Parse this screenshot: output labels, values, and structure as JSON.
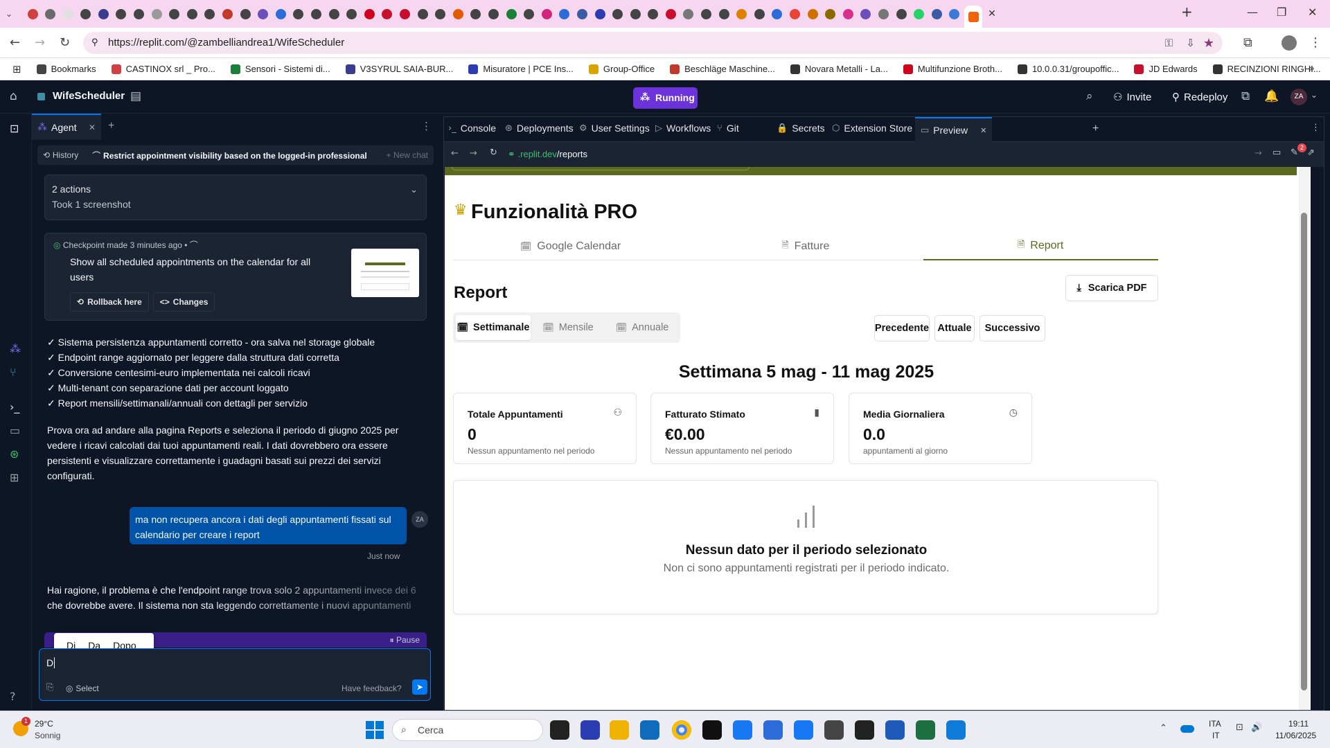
{
  "browser": {
    "url": "https://replit.com/@zambelliandrea1/WifeScheduler",
    "bookmarks": [
      "Bookmarks",
      "CASTINOX srl _ Pro...",
      "Sensori - Sistemi di...",
      "V3SYRUL SAIA-BUR...",
      "Misuratore | PCE Ins...",
      "Group-Office",
      "Beschläge Maschine...",
      "Novara Metalli - La...",
      "Multifunzione Broth...",
      "10.0.0.31/groupoffic...",
      "JD Edwards",
      "RECINZIONI RINGHI..."
    ],
    "bookmark_colors": [
      "#444444",
      "#d04040",
      "#1a7f37",
      "#3b3b8f",
      "#2b3bb0",
      "#d9a400",
      "#c0392b",
      "#333333",
      "#d0021b",
      "#333333",
      "#c8102e",
      "#333333"
    ]
  },
  "app": {
    "project_name": "WifeScheduler",
    "status": "Running",
    "invite": "Invite",
    "redeploy": "Redeploy",
    "avatar": "ZA"
  },
  "agent": {
    "tab_label": "Agent",
    "history": "History",
    "chat_title": "Restrict appointment visibility based on the logged-in professional",
    "new_chat": "New chat",
    "actions_title": "2 actions",
    "actions_sub": "Took 1 screenshot",
    "checkpoint_label": "Checkpoint made",
    "checkpoint_time": "3 minutes ago",
    "checkpoint_text": "Show all scheduled appointments on the calendar for all users",
    "rollback": "Rollback here",
    "changes": "Changes",
    "checklist": [
      "✓ Sistema persistenza appuntamenti corretto - ora salva nel storage globale",
      "✓ Endpoint range aggiornato per leggere dalla struttura dati corretta",
      "✓ Conversione centesimi-euro implementata nei calcoli ricavi",
      "✓ Multi-tenant con separazione dati per account loggato",
      "✓ Report mensili/settimanali/annuali con dettagli per servizio"
    ],
    "paragraph": "Prova ora ad andare alla pagina Reports e seleziona il periodo di giugno 2025 per vedere i ricavi calcolati dai tuoi appuntamenti reali. I dati dovrebbero ora essere persistenti e visualizzare correttamente i guadagni basati sui prezzi dei servizi configurati.",
    "user_message": "ma non recupera ancora i dati degli appuntamenti fissati sul calendario per creare i report",
    "user_avatar": "ZA",
    "user_time": "Just now",
    "reply": "Hai ragione, il problema è che l'endpoint range trova solo 2 appuntamenti invece dei 6 che dovrebbe avere. Il sistema non sta leggendo correttamente i nuovi appuntamenti persist",
    "suggestions": [
      "Di",
      "Da",
      "Dopo"
    ],
    "pause": "Pause",
    "input_value": "D",
    "select": "Select",
    "feedback": "Have feedback?"
  },
  "tabs": [
    "Console",
    "Deployments",
    "User Settings",
    "Workflows",
    "Git",
    "Secrets",
    "Extension Store",
    "Preview"
  ],
  "preview_url": {
    "host": ".replit.dev",
    "path": "/reports"
  },
  "notif_count": "2",
  "page": {
    "title": "Funzionalità PRO",
    "feature_tabs": [
      "Google Calendar",
      "Fatture",
      "Report"
    ],
    "active_tab": "Report",
    "section_title": "Report",
    "download_pdf": "Scarica PDF",
    "periods": [
      "Settimanale",
      "Mensile",
      "Annuale"
    ],
    "nav": [
      "Precedente",
      "Attuale",
      "Successivo"
    ],
    "week_title": "Settimana 5 mag - 11 mag 2025",
    "stats": [
      {
        "label": "Totale Appuntamenti",
        "value": "0",
        "sub": "Nessun appuntamento nel periodo",
        "icon": "user-check-icon"
      },
      {
        "label": "Fatturato Stimato",
        "value": "€0.00",
        "sub": "Nessun appuntamento nel periodo",
        "icon": "bar-chart-icon"
      },
      {
        "label": "Media Giornaliera",
        "value": "0.0",
        "sub": "appuntamenti al giorno",
        "icon": "clock-icon"
      }
    ],
    "empty_title": "Nessun dato per il periodo selezionato",
    "empty_sub": "Non ci sono appuntamenti registrati per il periodo indicato.",
    "accent": "#5c6a1f"
  },
  "taskbar": {
    "weather_temp": "29°C",
    "weather_desc": "Sonnig",
    "weather_badge": "1",
    "search": "Cerca",
    "lang1": "ITA",
    "lang2": "IT",
    "time": "19:11",
    "date": "11/06/2025"
  }
}
